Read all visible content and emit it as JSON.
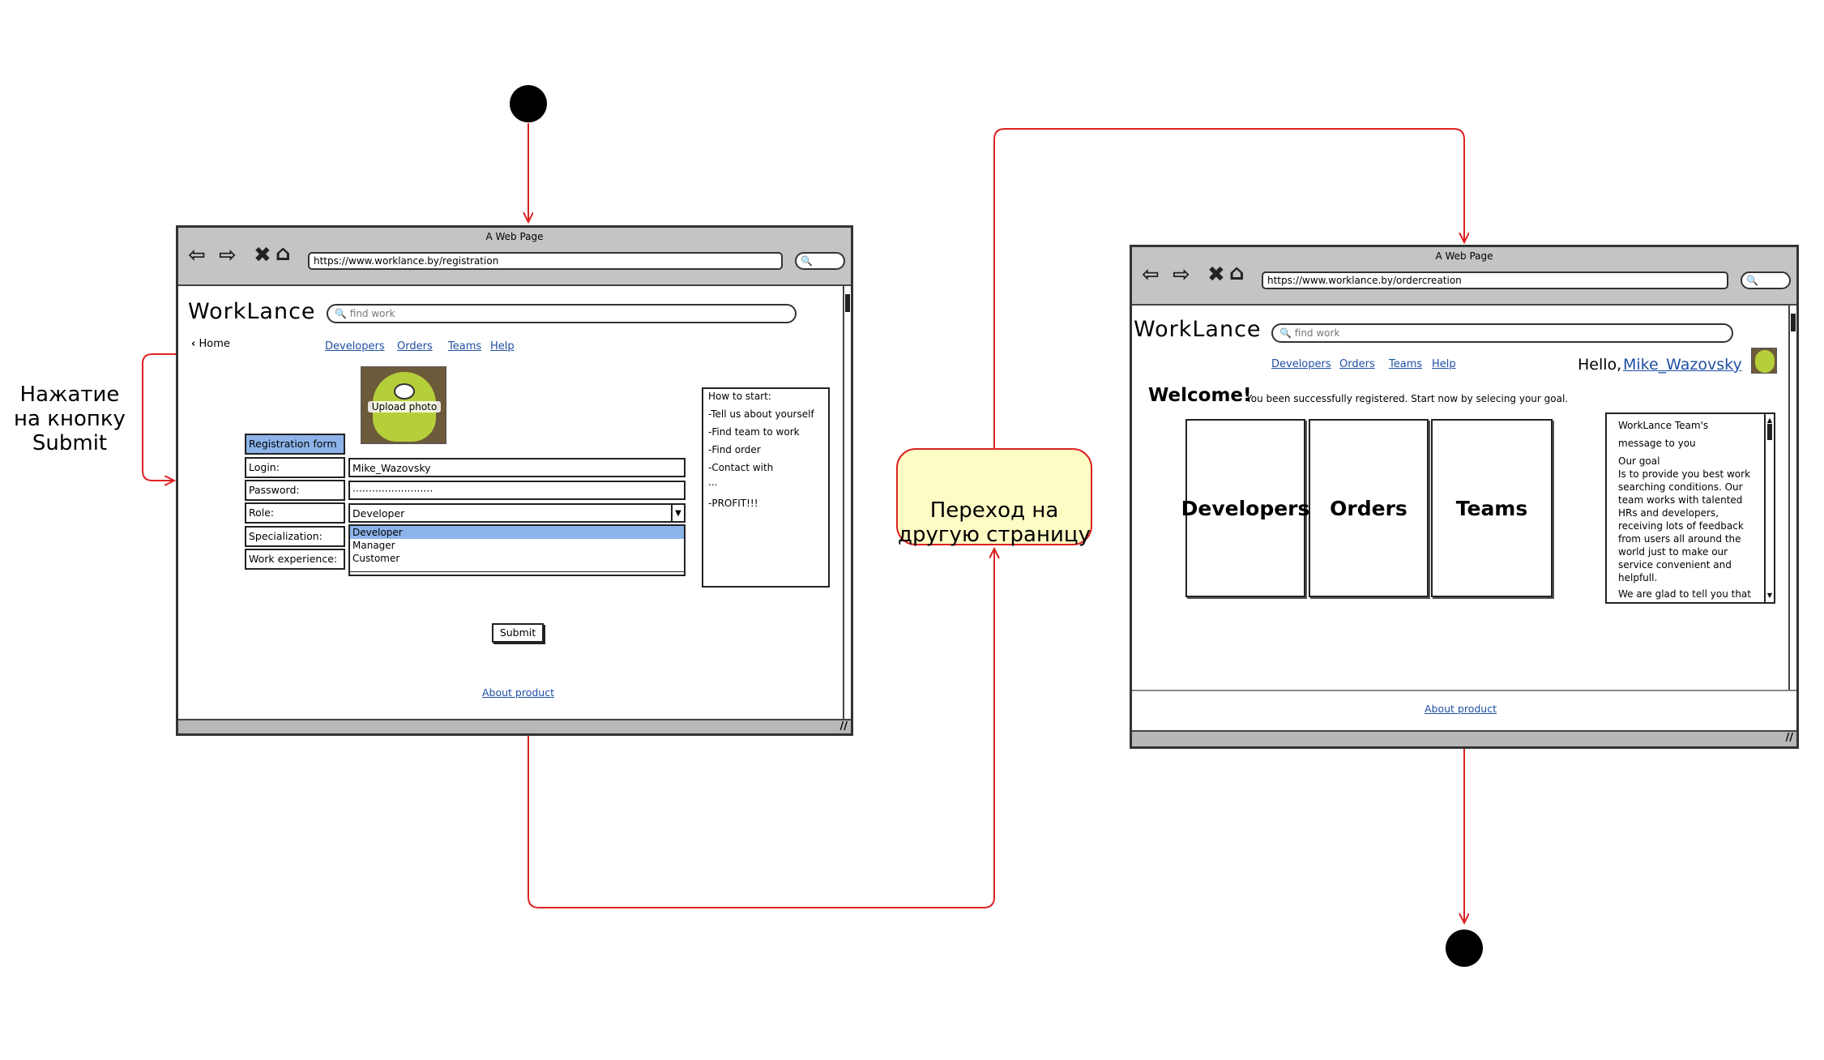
{
  "diagram": {
    "note_left": "Нажатие\nна кнопку\nSubmit",
    "note_middle": "Переход на\nдругую страницу",
    "colors": {
      "arrow": "#dd2222",
      "note_fill": "#fdfcc4",
      "note_border": "#dd2222",
      "node": "#000000"
    }
  },
  "registration_window": {
    "title": "A Web Page",
    "url": "https://www.worklance.by/registration",
    "brand": "WorkLance",
    "search_placeholder": "find work",
    "home_link": "Home",
    "nav": [
      "Developers",
      "Orders",
      "Teams",
      "Help"
    ],
    "upload_label": "Upload photo",
    "form": {
      "header": "Registration form",
      "fields": [
        {
          "label": "Login:",
          "value": "Mike_Wazovsky"
        },
        {
          "label": "Password:",
          "value": "·························"
        },
        {
          "label": "Role:",
          "value": "Developer"
        },
        {
          "label": "Specialization:",
          "value": ""
        },
        {
          "label": "Work experience:",
          "value": ""
        }
      ],
      "role_options": [
        "Developer",
        "Manager",
        "Customer"
      ]
    },
    "submit_label": "Submit",
    "howto": [
      "How to start:",
      "-Tell us about yourself",
      "-Find team to work",
      "-Find order",
      "-Contact with",
      "...",
      "-PROFIT!!!"
    ],
    "footer_link": "About product"
  },
  "welcome_window": {
    "title": "A Web Page",
    "url": "https://www.worklance.by/ordercreation",
    "brand": "WorkLance",
    "search_placeholder": "find work",
    "nav": [
      "Developers",
      "Orders",
      "Teams",
      "Help"
    ],
    "greeting": "Hello,",
    "username": "Mike_Wazovsky",
    "welcome_title": "Welcome!",
    "welcome_text": "You been successfully registered. Start now by selecing your goal.",
    "tiles": [
      "Developers",
      "Orders",
      "Teams"
    ],
    "message_lines": [
      "WorkLance Team's",
      "message to you",
      "Our goal",
      "Is to provide you best work",
      "searching conditions. Our",
      "team works with talented",
      "HRs and developers,",
      "receiving lots of feedback",
      "from users all around the",
      "world just to make our",
      "service convenient and",
      "helpfull.",
      "We are glad to tell you that"
    ],
    "footer_link": "About product"
  }
}
